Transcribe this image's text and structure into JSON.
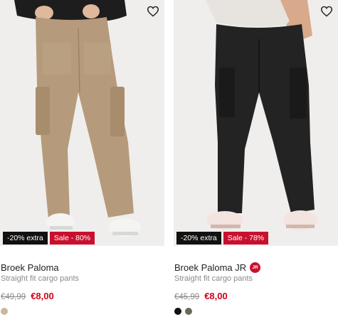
{
  "products": [
    {
      "name": "Broek Paloma",
      "badge": null,
      "description": "Straight fit cargo pants",
      "old_price": "€49,99",
      "new_price": "€8,00",
      "tags": [
        "-20% extra",
        "Sale - 80%"
      ],
      "swatches": [
        "#cdb79a"
      ],
      "wishlist_icon": "heart-outline-icon"
    },
    {
      "name": "Broek Paloma JR",
      "badge": "JR",
      "description": "Straight fit cargo pants",
      "old_price": "€45,99",
      "new_price": "€8,00",
      "tags": [
        "-20% extra",
        "Sale - 78%"
      ],
      "swatches": [
        "#111111",
        "#6b6a5a"
      ],
      "wishlist_icon": "heart-outline-icon"
    }
  ],
  "colors": {
    "sale_red": "#c8102e",
    "price_red": "#d0021b"
  }
}
